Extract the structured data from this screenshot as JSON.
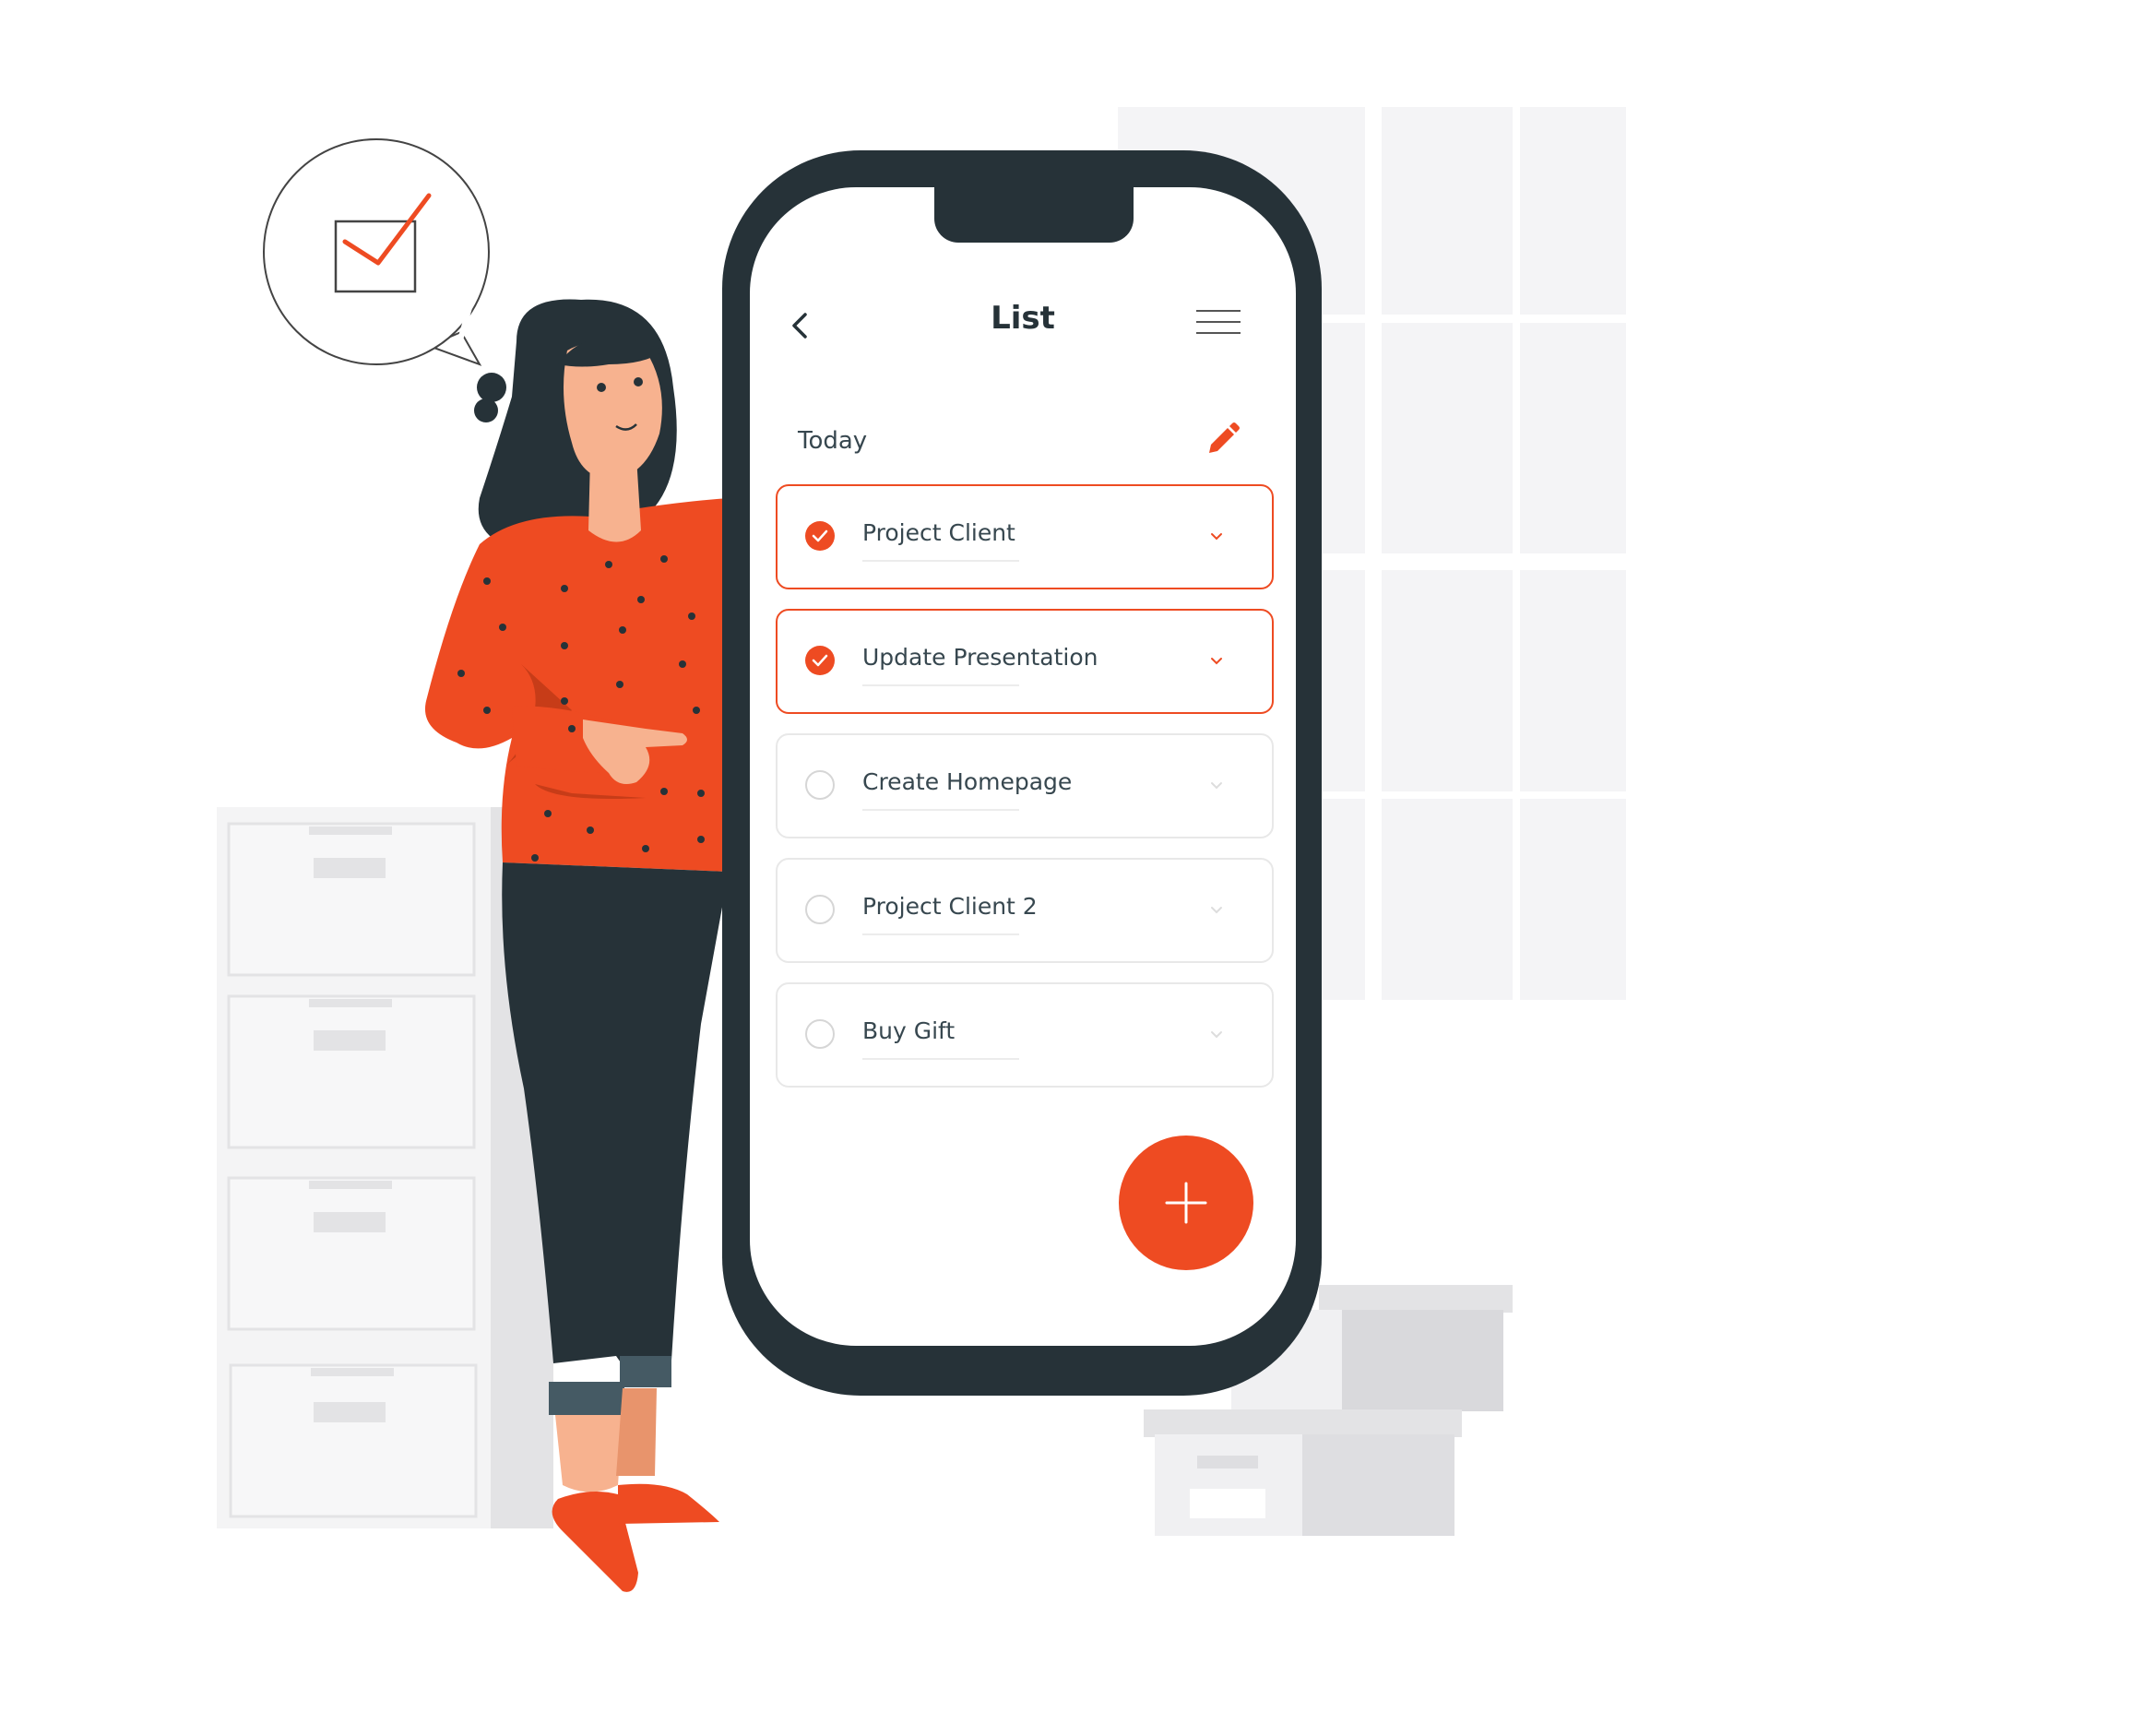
{
  "app": {
    "title": "List",
    "section": "Today"
  },
  "tasks": [
    {
      "label": "Project Client",
      "completed": true
    },
    {
      "label": "Update Presentation",
      "completed": true
    },
    {
      "label": "Create Homepage",
      "completed": false
    },
    {
      "label": "Project Client 2",
      "completed": false
    },
    {
      "label": "Buy Gift",
      "completed": false
    }
  ],
  "icons": {
    "back": "chevron-left-icon",
    "menu": "hamburger-menu-icon",
    "edit": "pencil-icon",
    "check": "check-icon",
    "expand": "chevron-down-icon",
    "add": "plus-icon",
    "speech_bubble": "checkbox-checked-icon"
  },
  "colors": {
    "accent": "#ee4b22",
    "dark": "#263238",
    "text": "#37474f",
    "background_shapes": "#f5f5f5"
  }
}
